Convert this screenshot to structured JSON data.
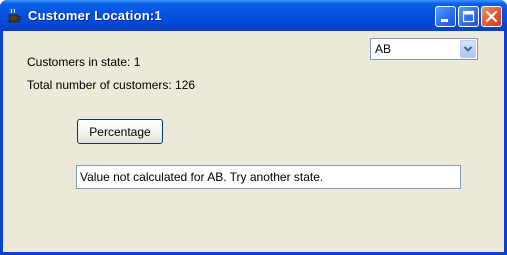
{
  "window": {
    "title": "Customer Location:1",
    "icon": "coffee-cup-icon"
  },
  "title_buttons": [
    "minimize-icon",
    "maximize-icon",
    "close-icon"
  ],
  "state_select": {
    "selected": "AB"
  },
  "stats": {
    "customers_in_state": "Customers in state: 1",
    "total_customers": "Total number of customers: 126"
  },
  "percentage_button": {
    "label": "Percentage"
  },
  "result_field": {
    "value": "Value not calculated for AB. Try another state."
  },
  "colors": {
    "titlebar": "#0553e0",
    "client_bg": "#ece9d8",
    "close_button": "#e2572f"
  }
}
